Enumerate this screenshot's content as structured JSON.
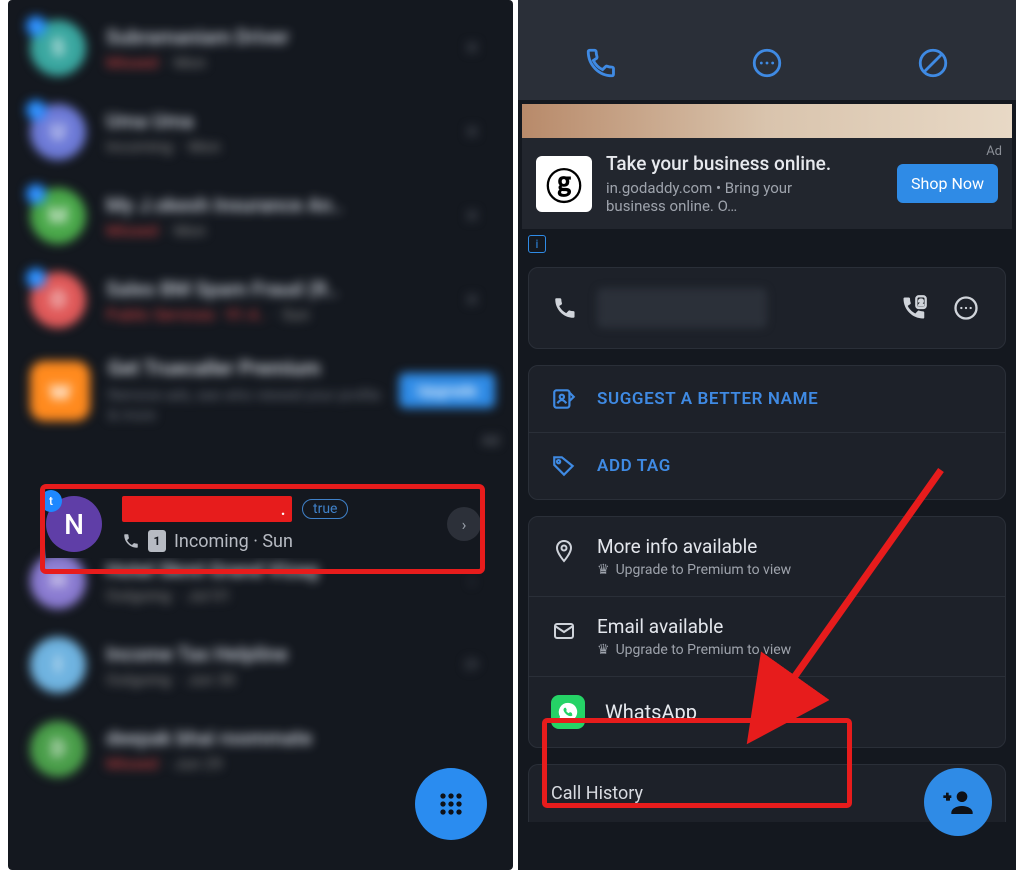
{
  "left": {
    "calls": [
      {
        "initial": "S",
        "color": "#3aa7a0",
        "name": "Subramaniam Driver",
        "status": "Missed",
        "statusType": "miss",
        "day": "Mon"
      },
      {
        "initial": "U",
        "color": "#6e7bd8",
        "name": "Uma Uma",
        "status": "Incoming",
        "statusType": "in",
        "day": "Mon"
      },
      {
        "initial": "M",
        "color": "#4aa84a",
        "name": "My J.okesh Insurance An..",
        "status": "Missed",
        "statusType": "miss",
        "day": "Mon"
      },
      {
        "initial": "O",
        "color": "#e05a5a",
        "name": "Sales BM Spam Fraud (R..",
        "status": "Public Services · 91.4..",
        "statusType": "miss",
        "day": "Sun"
      }
    ],
    "promo": {
      "title": "Get Truecaller Premium",
      "sub": "Remove ads, see who viewed your profile & more",
      "cta": "Upgrade",
      "ad": "Ad"
    },
    "selected": {
      "avatar": "N",
      "truePill": "true",
      "sub": "Incoming · Sun",
      "sim": "1"
    },
    "callsAfter": [
      {
        "initial": "H",
        "color": "#8a7bd1",
        "name": "Hotel Skml Grand Vizag",
        "status": "Outgoing",
        "day": "Jul 01"
      },
      {
        "initial": "I",
        "color": "#6fb3e0",
        "name": "Income Tax Helpline",
        "status": "Outgoing",
        "day": "Jun 30"
      },
      {
        "initial": "D",
        "color": "#4a9e4a",
        "name": "deepak bhai roommate",
        "status": "Missed",
        "statusType": "miss",
        "day": "Jun 29"
      }
    ]
  },
  "right": {
    "ad": {
      "title": "Take your business online.",
      "sub": "in.godaddy.com • Bring your business online. O…",
      "cta": "Shop Now",
      "label": "Ad"
    },
    "suggest": "SUGGEST A BETTER NAME",
    "addTag": "ADD TAG",
    "moreInfo": {
      "title": "More info available",
      "sub": "Upgrade to Premium to view"
    },
    "email": {
      "title": "Email available",
      "sub": "Upgrade to Premium to view"
    },
    "whatsapp": "WhatsApp",
    "history": "Call History"
  }
}
